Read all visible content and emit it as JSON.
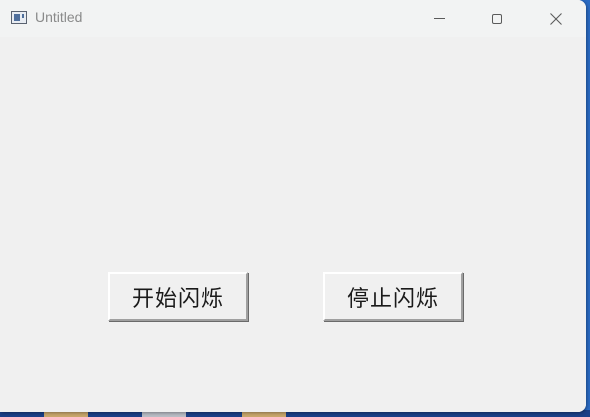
{
  "window": {
    "title": "Untitled",
    "controls": {
      "minimize": "minimize-icon",
      "maximize": "maximize-icon",
      "close": "close-icon"
    }
  },
  "buttons": {
    "start_label": "开始闪烁",
    "stop_label": "停止闪烁"
  },
  "colors": {
    "window_bg": "#f0f0f0",
    "titlebar_bg": "#f2f3f3",
    "title_text": "#8a8a8a",
    "button_text": "#1a1a1a"
  }
}
